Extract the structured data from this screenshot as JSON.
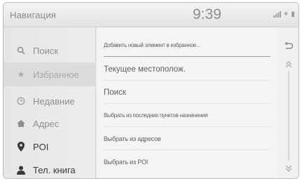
{
  "header": {
    "title": "Навигация",
    "clock": "9:39"
  },
  "sidebar": {
    "items": [
      {
        "label": "Поиск",
        "icon": "search-icon"
      },
      {
        "label": "Избранное",
        "icon": "star-icon"
      },
      {
        "label": "Недавние",
        "icon": "clock-icon"
      },
      {
        "label": "Адрес",
        "icon": "address-icon"
      },
      {
        "label": "POI",
        "icon": "poi-pin-icon"
      },
      {
        "label": "Тел. книга",
        "icon": "person-icon"
      }
    ],
    "active_index": 1
  },
  "list": {
    "items": [
      "Добавить новый элемент в избранное...",
      "Текущее местополож.",
      "Поиск",
      "Выбрать из последних пунктов назначения",
      "Выбрать из адресов",
      "Выбрать из POI"
    ]
  },
  "colors": {
    "background": "#ececec",
    "active_item": "#dcdcdc",
    "text": "#606060"
  }
}
